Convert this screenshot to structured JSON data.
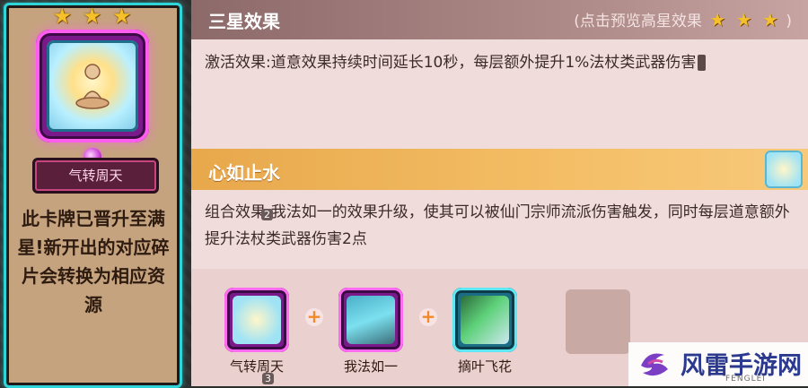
{
  "card": {
    "stars": [
      "★",
      "★",
      "★"
    ],
    "name": "气转周天",
    "description": "此卡牌已晋升至满星!新开出的对应碎片会转换为相应资源"
  },
  "three_star": {
    "title": "三星效果",
    "hint": "(点击预览高星效果",
    "hint_stars": [
      "★",
      "★",
      "★"
    ],
    "hint_close": ")",
    "effect_text": "激活效果:道意效果持续时间延长10秒，每层额外提升1%法杖类武器伤害"
  },
  "combo": {
    "title": "心如止水",
    "effect_text": "组合效果:我法如一的效果升级，使其可以被仙门宗师流派伤害触发，同时每层道意额外提升法杖类武器伤害2点",
    "items": [
      {
        "name": "气转周天",
        "icon": "monk-meditation-icon"
      },
      {
        "name": "我法如一",
        "icon": "sword-icon"
      },
      {
        "name": "摘叶飞花",
        "icon": "leaf-crystal-icon"
      }
    ],
    "plus_symbol": "+"
  },
  "markers": {
    "n2": "2",
    "n3": "3"
  },
  "watermark": {
    "text": "风雷手游网",
    "sub": "FENGLEI"
  },
  "colors": {
    "card_border": "#2fd4d9",
    "purple_frame": "#ff5cf0",
    "orange_header": "#f4be66"
  }
}
